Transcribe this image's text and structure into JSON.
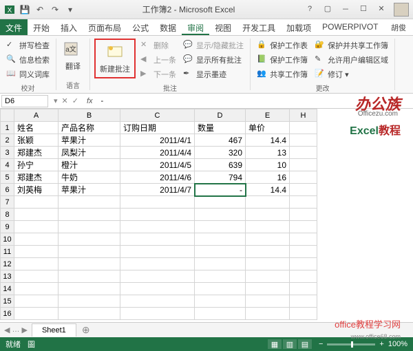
{
  "title": "工作簿2 - Microsoft Excel",
  "tabs": [
    "文件",
    "开始",
    "插入",
    "页面布局",
    "公式",
    "数据",
    "审阅",
    "视图",
    "开发工具",
    "加载项",
    "POWERPIVOT"
  ],
  "active_tab": "审阅",
  "user": "胡俊",
  "ribbon": {
    "proofing": {
      "label": "校对",
      "spell": "拼写检查",
      "research": "信息检索",
      "thesaurus": "同义词库"
    },
    "language": {
      "label": "语言",
      "translate": "翻译"
    },
    "comments": {
      "label": "批注",
      "new": "新建批注",
      "delete": "删除",
      "prev": "上一条",
      "next": "下一条",
      "showhide": "显示/隐藏批注",
      "showall": "显示所有批注",
      "ink": "显示墨迹"
    },
    "protect": {
      "label": "更改",
      "sheet": "保护工作表",
      "workbook": "保护工作簿",
      "share": "共享工作簿",
      "protectshare": "保护并共享工作簿",
      "allowedit": "允许用户编辑区域",
      "track": "修订"
    }
  },
  "namebox": "D6",
  "formula_val": "-",
  "columns": [
    "A",
    "B",
    "C",
    "D",
    "E",
    "H"
  ],
  "col_widths": [
    "col-A",
    "col-B",
    "col-C",
    "col-D",
    "col-E",
    "col-H"
  ],
  "headers": {
    "A": "姓名",
    "B": "产品名称",
    "C": "订购日期",
    "D": "数量",
    "E": "单价"
  },
  "rows": [
    {
      "A": "张颖",
      "B": "苹果汁",
      "C": "2011/4/1",
      "D": "467",
      "E": "14.4"
    },
    {
      "A": "郑建杰",
      "B": "凤梨汁",
      "C": "2011/4/4",
      "D": "320",
      "E": "13"
    },
    {
      "A": "孙宁",
      "B": "橙汁",
      "C": "2011/4/5",
      "D": "639",
      "E": "10"
    },
    {
      "A": "郑建杰",
      "B": "牛奶",
      "C": "2011/4/6",
      "D": "794",
      "E": "16"
    },
    {
      "A": "刘英梅",
      "B": "苹果汁",
      "C": "2011/4/7",
      "D": "-",
      "E": "14.4"
    }
  ],
  "selected_cell": "D6",
  "sheet": "Sheet1",
  "status": "就绪",
  "status2": "圖",
  "zoom": "100%",
  "watermark": {
    "brand": "办公族",
    "brand_blue": "公",
    "url": "Officezu.com",
    "tutorial_g": "Excel",
    "tutorial_r": "教程",
    "site": "office教程学习网",
    "siteurl": "www.office68.com"
  }
}
